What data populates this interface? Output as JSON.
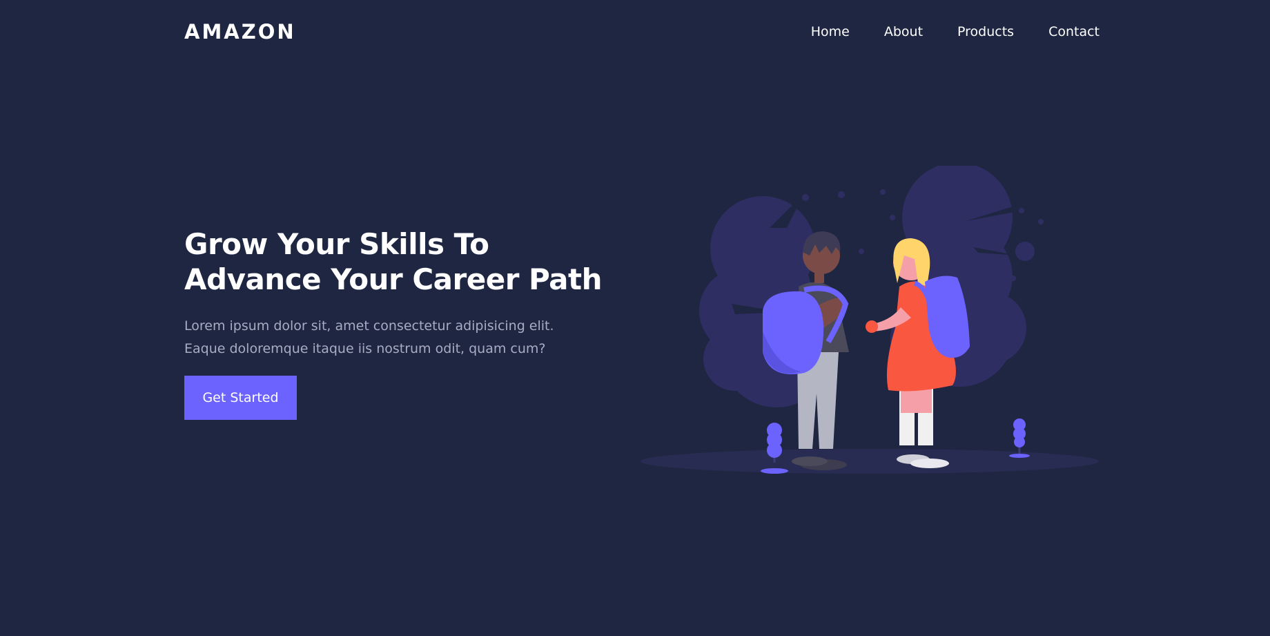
{
  "brand": {
    "logo_text": "AMAZON"
  },
  "nav": {
    "items": [
      {
        "label": "Home"
      },
      {
        "label": "About"
      },
      {
        "label": "Products"
      },
      {
        "label": "Contact"
      }
    ]
  },
  "hero": {
    "title": "Grow Your Skills To Advance Your Career Path",
    "description": "Lorem ipsum dolor sit, amet consectetur adipisicing elit. Eaque doloremque itaque iis nostrum odit, quam cum?",
    "cta_label": "Get Started",
    "illustration": "students-with-backpacks-illustration"
  },
  "colors": {
    "background": "#1f2642",
    "accent": "#6c63ff",
    "bush": "#2f2e63",
    "text_muted": "#a9adc3"
  }
}
